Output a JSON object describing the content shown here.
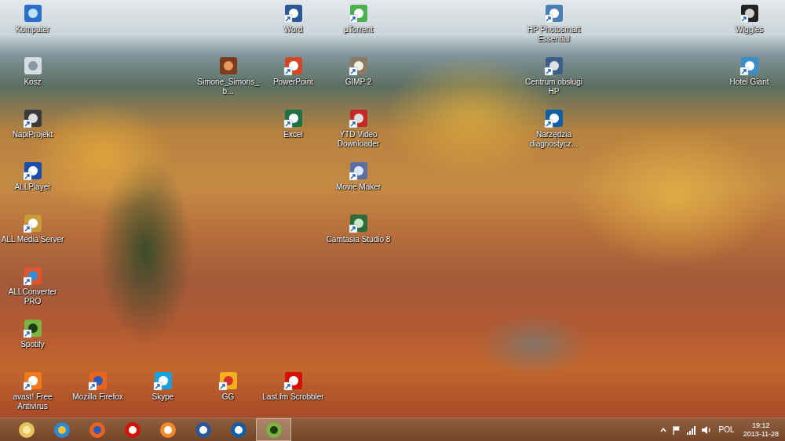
{
  "desktop": {
    "icons": [
      {
        "label": "Komputer",
        "kind": "computer",
        "shortcut": false
      },
      {
        "label": "Kosz",
        "kind": "recycle",
        "shortcut": false
      },
      {
        "label": "NapiProjekt",
        "kind": "napi",
        "shortcut": true
      },
      {
        "label": "ALLPlayer",
        "kind": "allplayer",
        "shortcut": true
      },
      {
        "label": "ALL Media Server",
        "kind": "allmedia",
        "shortcut": true
      },
      {
        "label": "ALLConverter PRO",
        "kind": "allconverter",
        "shortcut": true
      },
      {
        "label": "Spotify",
        "kind": "spotify",
        "shortcut": true
      },
      {
        "label": "avast! Free Antivirus",
        "kind": "avast",
        "shortcut": true
      },
      {
        "label": "Mozilla Firefox",
        "kind": "firefox",
        "shortcut": true
      },
      {
        "label": "Skype",
        "kind": "skype",
        "shortcut": true
      },
      {
        "label": "Simone_Simons_b...",
        "kind": "image",
        "shortcut": false
      },
      {
        "label": "GG",
        "kind": "gg",
        "shortcut": true
      },
      {
        "label": "Word",
        "kind": "word",
        "shortcut": true
      },
      {
        "label": "PowerPoint",
        "kind": "powerpoint",
        "shortcut": true
      },
      {
        "label": "Excel",
        "kind": "excel",
        "shortcut": true
      },
      {
        "label": "Last.fm Scrobbler",
        "kind": "lastfm",
        "shortcut": true
      },
      {
        "label": "µTorrent",
        "kind": "utorrent",
        "shortcut": true
      },
      {
        "label": "GIMP 2",
        "kind": "gimp",
        "shortcut": true
      },
      {
        "label": "YTD Video Downloader",
        "kind": "ytd",
        "shortcut": true
      },
      {
        "label": "Movie Maker",
        "kind": "moviemaker",
        "shortcut": true
      },
      {
        "label": "Camtasia Studio 8",
        "kind": "camtasia",
        "shortcut": true
      },
      {
        "label": "HP Photosmart Essential",
        "kind": "hpphoto",
        "shortcut": true
      },
      {
        "label": "Centrum obsługi HP",
        "kind": "hpcenter",
        "shortcut": true
      },
      {
        "label": "Narzędzia diagnostycz...",
        "kind": "hp",
        "shortcut": true
      },
      {
        "label": "Wiggles",
        "kind": "wiggles",
        "shortcut": true
      },
      {
        "label": "Hotel Giant",
        "kind": "hotel",
        "shortcut": true
      }
    ]
  },
  "taskbar": {
    "buttons": [
      {
        "kind": "explorer",
        "active": false
      },
      {
        "kind": "ie",
        "active": false
      },
      {
        "kind": "firefox",
        "active": false
      },
      {
        "kind": "lastfm",
        "active": false
      },
      {
        "kind": "player",
        "active": false
      },
      {
        "kind": "word",
        "active": false
      },
      {
        "kind": "hp",
        "active": false
      },
      {
        "kind": "spotify",
        "active": true
      }
    ]
  },
  "tray": {
    "language": "POL",
    "time": "19:12",
    "date": "2013-11-28"
  }
}
